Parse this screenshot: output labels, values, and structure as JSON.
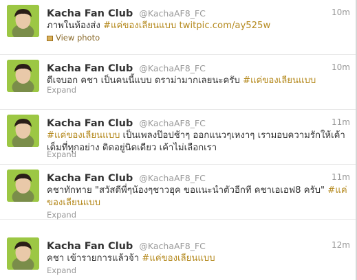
{
  "tweets": [
    {
      "name": "Kacha Fan Club",
      "handle": "@KachaAF8_FC",
      "time": "10m",
      "text_before": "ภาพในห้องส่ง ",
      "hashtag": "#แค่ของเลียนแบบ",
      "text_after": " ",
      "link": "twitpic.com/ay525w",
      "action": "View photo"
    },
    {
      "name": "Kacha Fan Club",
      "handle": "@KachaAF8_FC",
      "time": "10m",
      "text_before": "ดีเจบอก คชา เป็นคนนี้แบบ ดราม่ามากเลยนะครับ ",
      "hashtag": "#แค่ของเลียนแบบ",
      "action": "Expand"
    },
    {
      "name": "Kacha Fan Club",
      "handle": "@KachaAF8_FC",
      "time": "11m",
      "hashtag": "#แค่ของเลียนแบบ",
      "text_after": " เป็นเพลงป๊อปช้าๆ ออกแนวๆเหงาๆ เรามอบความรักให้เค้าเต็มที่ทุกอย่าง ติดอยู่นิดเดียว เค้าไม่เลือกเรา",
      "action": "Expand"
    },
    {
      "name": "Kacha Fan Club",
      "handle": "@KachaAF8_FC",
      "time": "11m",
      "text_before": "คชาทักทาย \"สวัสดีพี่ๆน้องๆชาวฮุค ขอแนะนำตัวอีกที คชาเอเอฟ8 ครับ\" ",
      "hashtag": "#แค่ของเลียนแบบ",
      "action": "Expand"
    },
    {
      "name": "Kacha Fan Club",
      "handle": "@KachaAF8_FC",
      "time": "12m",
      "text_before": "คชา เข้ารายการแล้วจ้า ",
      "hashtag": "#แค่ของเลียนแบบ",
      "action": "Expand"
    }
  ],
  "colors": {
    "hashtag": "#b58a1f",
    "muted": "#999999",
    "avatar_bg": "#8fbf3a"
  }
}
